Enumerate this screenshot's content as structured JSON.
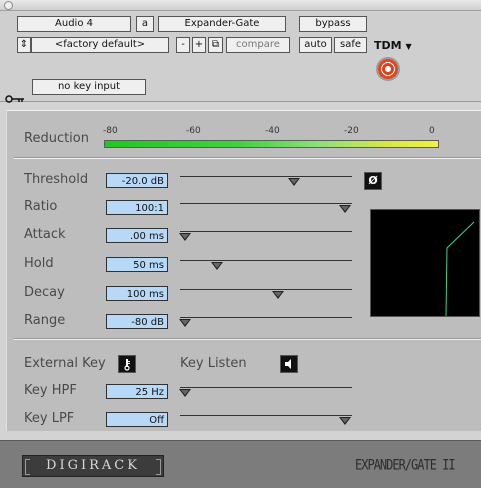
{
  "header": {
    "track": "Audio 4",
    "insert": "a",
    "plugin": "Expander-Gate",
    "bypass": "bypass",
    "format": "TDM",
    "preset": "<factory default>",
    "prev": "-",
    "next": "+",
    "compare": "compare",
    "auto": "auto",
    "safe": "safe",
    "key_input": "no key input"
  },
  "meter": {
    "label": "Reduction",
    "scale": [
      "-80",
      "-60",
      "-40",
      "-20",
      "0"
    ]
  },
  "params": [
    {
      "label": "Threshold",
      "value": "-20.0 dB",
      "level": 0.68
    },
    {
      "label": "Ratio",
      "value": "100:1",
      "level": 1.0
    },
    {
      "label": "Attack",
      "value": ".00 ms",
      "level": 0.0
    },
    {
      "label": "Hold",
      "value": "50 ms",
      "level": 0.2
    },
    {
      "label": "Decay",
      "value": "100 ms",
      "level": 0.58
    },
    {
      "label": "Range",
      "value": "-80 dB",
      "level": 0.0
    }
  ],
  "phase_symbol": "Ø",
  "key": {
    "external_label": "External Key",
    "listen_label": "Key Listen",
    "hpf_label": "Key HPF",
    "hpf_value": "25 Hz",
    "hpf_level": 0.0,
    "lpf_label": "Key LPF",
    "lpf_value": "Off",
    "lpf_level": 1.0
  },
  "footer": {
    "brand": "DIGIRACK",
    "plugin_name": "EXPANDER/GATE II"
  },
  "colors": {
    "field": "#b8d8f8",
    "record": "#e0401e",
    "graph_line": "#3fd28a"
  }
}
